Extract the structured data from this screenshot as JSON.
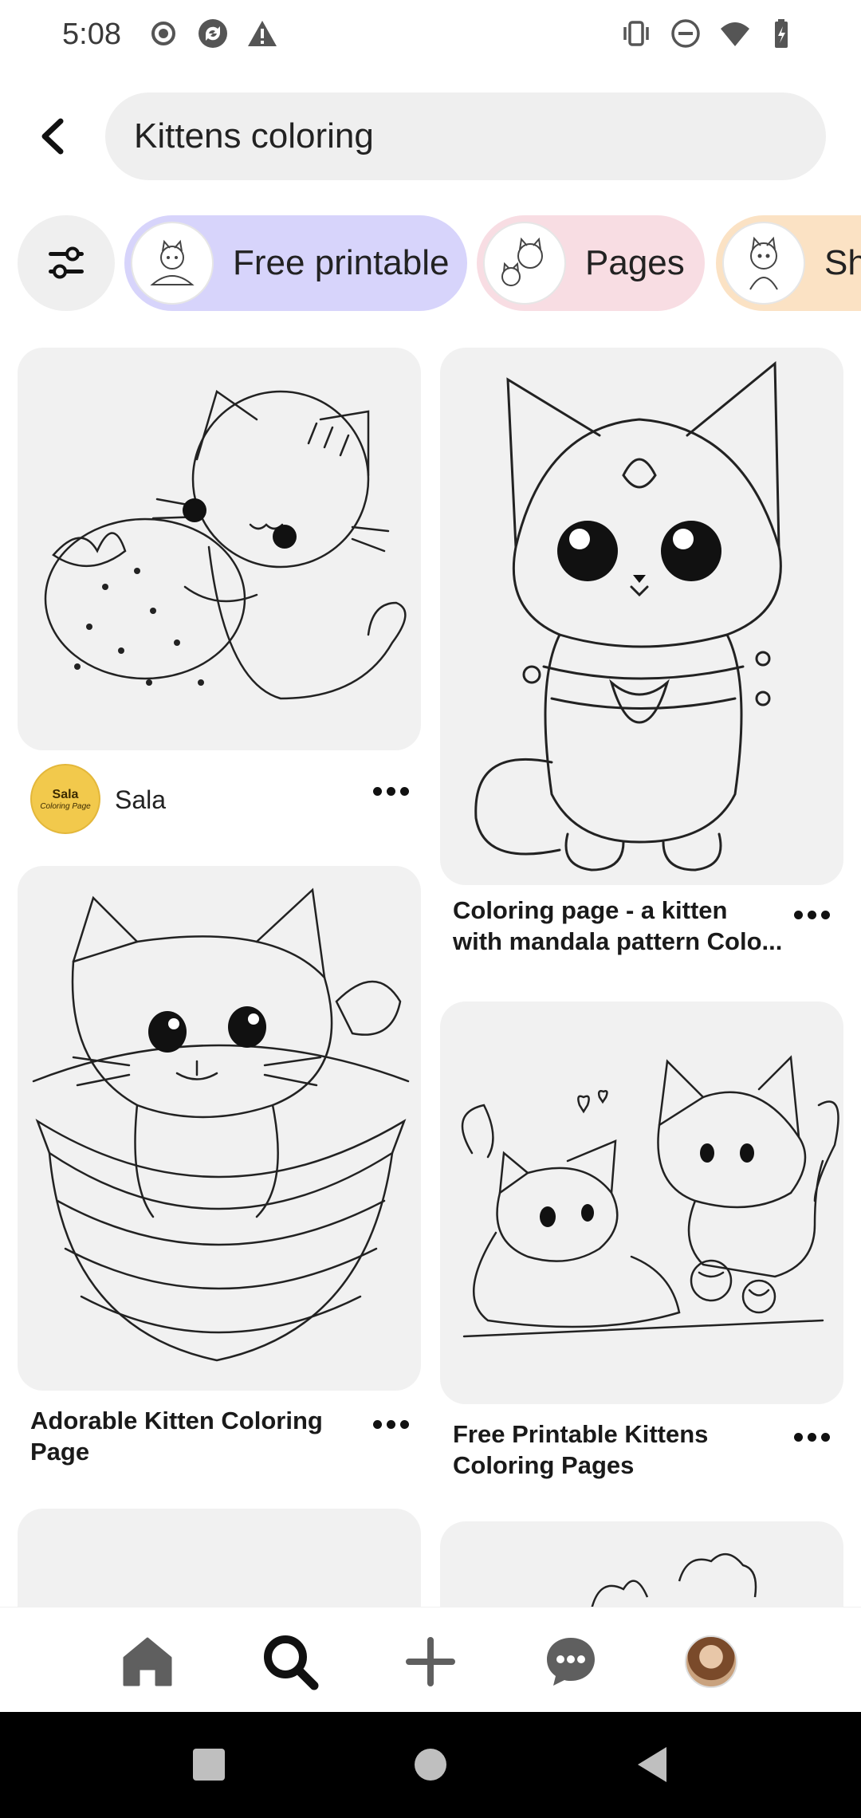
{
  "status_bar": {
    "time": "5:08",
    "left_icons": [
      "record-icon",
      "sync-icon",
      "warning-icon"
    ],
    "right_icons": [
      "vibrate-icon",
      "do-not-disturb-icon",
      "wifi-icon",
      "battery-icon"
    ]
  },
  "search": {
    "query": "Kittens coloring"
  },
  "chips": [
    {
      "label": "Free printable",
      "bg": "#d7d4fb"
    },
    {
      "label": "Pages",
      "bg": "#f8dde3"
    },
    {
      "label": "Sh",
      "bg": "#fbe2c4"
    }
  ],
  "pins": {
    "left": [
      {
        "creator": "Sala",
        "avatar_text_1": "Sala",
        "avatar_text_2": "Coloring Page"
      },
      {
        "title_line1": "Adorable Kitten Coloring",
        "title_line2": "Page"
      }
    ],
    "right": [
      {
        "title_line1": "Coloring page - a kitten",
        "title_line2": "with mandala pattern Colo..."
      },
      {
        "title_line1": "Free Printable Kittens",
        "title_line2": "Coloring Pages"
      }
    ]
  },
  "bottom_nav": {
    "items": [
      "home-icon",
      "search-icon",
      "plus-icon",
      "messages-icon",
      "profile-avatar"
    ],
    "active": "search-icon"
  },
  "colors": {
    "chip_filter_bg": "#efefef",
    "search_bg": "#efefef",
    "pin_bg": "#f1f1f1",
    "nav_icon": "#5f5f5f"
  }
}
